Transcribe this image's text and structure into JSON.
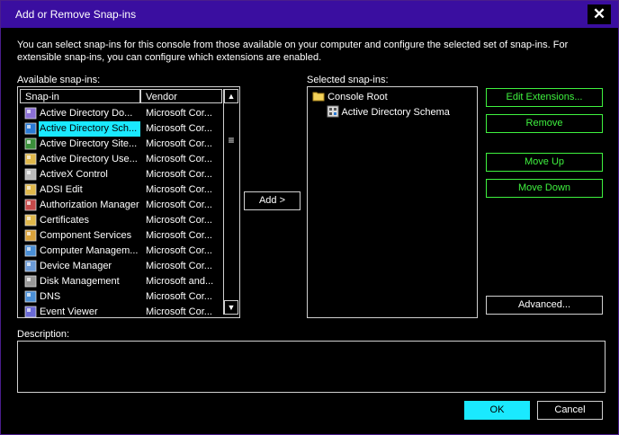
{
  "dialog": {
    "title": "Add or Remove Snap-ins",
    "close_glyph": "✕",
    "intro": "You can select snap-ins for this console from those available on your computer and configure the selected set of snap-ins. For extensible snap-ins, you can configure which extensions are enabled."
  },
  "available": {
    "label": "Available snap-ins:",
    "columns": [
      "Snap-in",
      "Vendor"
    ],
    "selected_index": 1,
    "items": [
      {
        "name": "Active Directory Do...",
        "vendor": "Microsoft Cor...",
        "icon": "ad-domains-icon"
      },
      {
        "name": "Active Directory Sch...",
        "vendor": "Microsoft Cor...",
        "icon": "ad-schema-icon"
      },
      {
        "name": "Active Directory Site...",
        "vendor": "Microsoft Cor...",
        "icon": "ad-sites-icon"
      },
      {
        "name": "Active Directory Use...",
        "vendor": "Microsoft Cor...",
        "icon": "ad-users-icon"
      },
      {
        "name": "ActiveX Control",
        "vendor": "Microsoft Cor...",
        "icon": "activex-icon"
      },
      {
        "name": "ADSI Edit",
        "vendor": "Microsoft Cor...",
        "icon": "adsi-edit-icon"
      },
      {
        "name": "Authorization Manager",
        "vendor": "Microsoft Cor...",
        "icon": "authorization-icon"
      },
      {
        "name": "Certificates",
        "vendor": "Microsoft Cor...",
        "icon": "certificates-icon"
      },
      {
        "name": "Component Services",
        "vendor": "Microsoft Cor...",
        "icon": "component-services-icon"
      },
      {
        "name": "Computer Managem...",
        "vendor": "Microsoft Cor...",
        "icon": "computer-management-icon"
      },
      {
        "name": "Device Manager",
        "vendor": "Microsoft Cor...",
        "icon": "device-manager-icon"
      },
      {
        "name": "Disk Management",
        "vendor": "Microsoft and...",
        "icon": "disk-management-icon"
      },
      {
        "name": "DNS",
        "vendor": "Microsoft Cor...",
        "icon": "dns-icon"
      },
      {
        "name": "Event Viewer",
        "vendor": "Microsoft Cor...",
        "icon": "event-viewer-icon"
      }
    ]
  },
  "add_button": "Add >",
  "selected": {
    "label": "Selected snap-ins:",
    "root": "Console Root",
    "child": "Active Directory Schema"
  },
  "buttons": {
    "edit_extensions": "Edit Extensions...",
    "remove": "Remove",
    "move_up": "Move Up",
    "move_down": "Move Down",
    "advanced": "Advanced...",
    "ok": "OK",
    "cancel": "Cancel"
  },
  "description": {
    "label": "Description:",
    "text": ""
  },
  "colors": {
    "title_bar": "#3a0ea0",
    "highlight": "#1ae9ff",
    "action_green": "#3ff23f"
  }
}
